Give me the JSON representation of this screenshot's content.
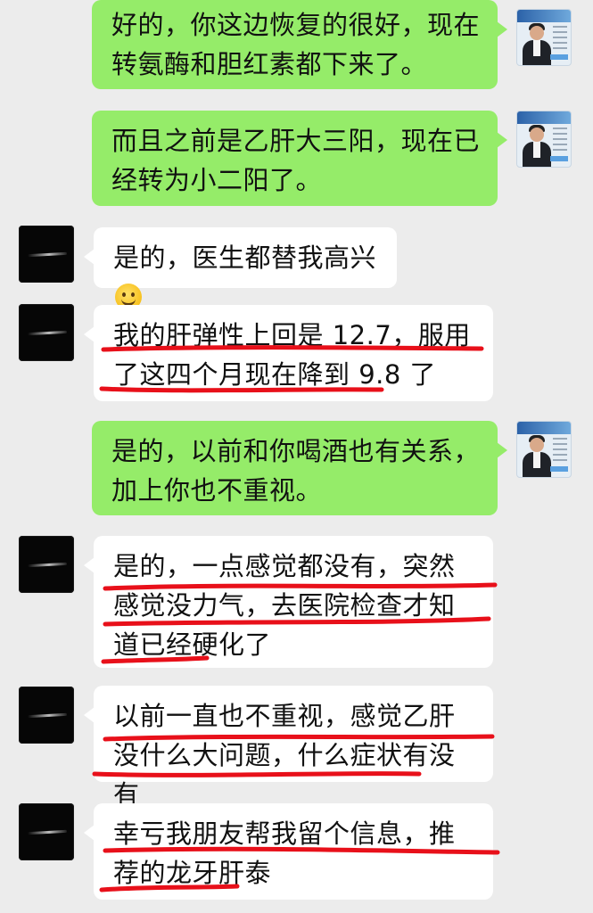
{
  "messages": [
    {
      "side": "out",
      "avatar": "doctor-avatar",
      "text": "好的，你这边恢复的很好，现在转氨酶和胆红素都下来了。"
    },
    {
      "side": "out",
      "avatar": "doctor-avatar",
      "text": "而且之前是乙肝大三阳，现在已经转为小二阳了。"
    },
    {
      "side": "in",
      "avatar": "dark-avatar",
      "text": "是的，医生都替我高兴",
      "emoji": "smile-emoji"
    },
    {
      "side": "in",
      "avatar": "dark-avatar",
      "text": "我的肝弹性上回是 12.7，服用了这四个月现在降到 9.8 了"
    },
    {
      "side": "out",
      "avatar": "doctor-avatar",
      "text": "是的，以前和你喝酒也有关系，加上你也不重视。"
    },
    {
      "side": "in",
      "avatar": "dark-avatar",
      "text": "是的，一点感觉都没有，突然感觉没力气，去医院检查才知道已经硬化了"
    },
    {
      "side": "in",
      "avatar": "dark-avatar",
      "text": "以前一直也不重视，感觉乙肝没什么大问题，什么症状有没有"
    },
    {
      "side": "in",
      "avatar": "dark-avatar",
      "text": "幸亏我朋友帮我留个信息，推荐的龙牙肝泰"
    }
  ],
  "colors": {
    "background": "#ececec",
    "outgoing_bubble": "#95ec69",
    "incoming_bubble": "#ffffff",
    "underline": "#e8101a"
  }
}
